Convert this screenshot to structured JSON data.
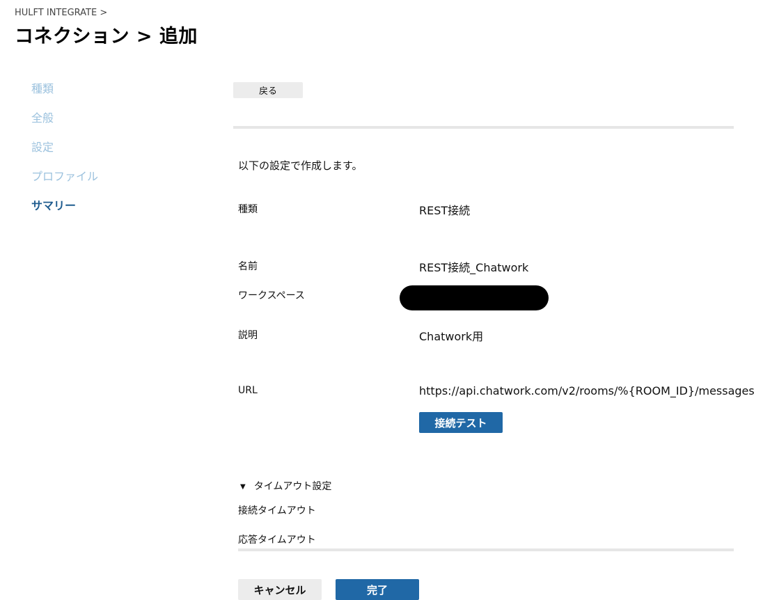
{
  "header": {
    "breadcrumb": "HULFT INTEGRATE >",
    "title": "コネクション > 追加"
  },
  "steps": [
    {
      "label": "種類",
      "active": false
    },
    {
      "label": "全般",
      "active": false
    },
    {
      "label": "設定",
      "active": false
    },
    {
      "label": "プロファイル",
      "active": false
    },
    {
      "label": "サマリー",
      "active": true
    }
  ],
  "toolbar": {
    "back_label": "戻る"
  },
  "summary": {
    "intro": "以下の設定で作成します。",
    "fields": {
      "type": {
        "label": "種類",
        "value": "REST接続"
      },
      "name": {
        "label": "名前",
        "value": "REST接続_Chatwork"
      },
      "workspace": {
        "label": "ワークスペース",
        "value": ""
      },
      "description": {
        "label": "説明",
        "value": "Chatwork用"
      },
      "url": {
        "label": "URL",
        "value": "https://api.chatwork.com/v2/rooms/%{ROOM_ID}/messages"
      }
    },
    "test_button_label": "接続テスト"
  },
  "timeout": {
    "toggle_icon": "▼",
    "section_label": "タイムアウト設定",
    "connect_label": "接続タイムアウト",
    "response_label": "応答タイムアウト"
  },
  "footer": {
    "cancel_label": "キャンセル",
    "done_label": "完了"
  },
  "colors": {
    "primary": "#2068a6",
    "step_inactive": "#9cc2de",
    "step_active": "#1f5c8f",
    "secondary_button": "#ececec",
    "divider": "#e6e6e6"
  }
}
